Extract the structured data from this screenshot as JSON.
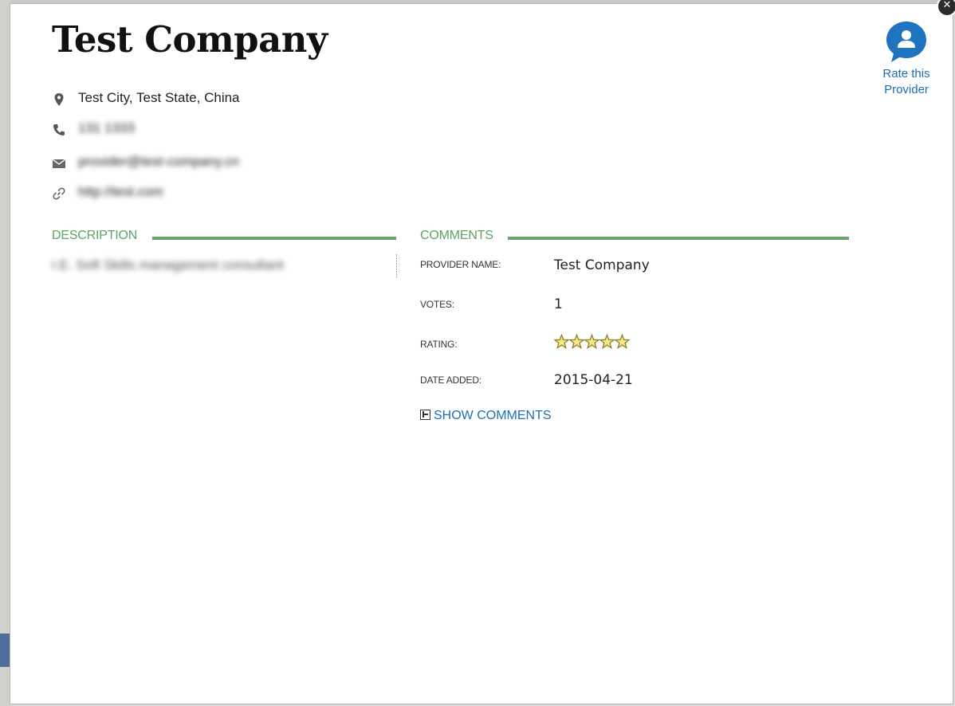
{
  "provider": {
    "name": "Test Company",
    "location": "Test City, Test State, China",
    "phone": "131 1333",
    "email": "provider@test-company.cn",
    "website": "http://test.com"
  },
  "actions": {
    "rate_label": "Rate this Provider",
    "show_comments_label": "SHOW COMMENTS"
  },
  "sections": {
    "description_heading": "DESCRIPTION",
    "description_text": "I.E. Soft Skills management consultant",
    "comments_heading": "COMMENTS"
  },
  "details": {
    "provider_name_label": "PROVIDER NAME:",
    "provider_name_value": "Test Company",
    "votes_label": "VOTES:",
    "votes_value": "1",
    "rating_label": "RATING:",
    "rating_value": 5,
    "rating_max": 5,
    "date_added_label": "DATE ADDED:",
    "date_added_value": "2015-04-21"
  },
  "colors": {
    "accent_green": "#6aa46d",
    "link_blue": "#1a6fb8",
    "star_fill": "#f6e88a",
    "star_stroke": "#8a7a20"
  },
  "icons": {
    "location": "map-pin-icon",
    "phone": "phone-icon",
    "email": "envelope-icon",
    "website": "link-icon",
    "rate": "user-speech-bubble-icon",
    "close": "close-icon",
    "expand": "plus-box-icon"
  }
}
